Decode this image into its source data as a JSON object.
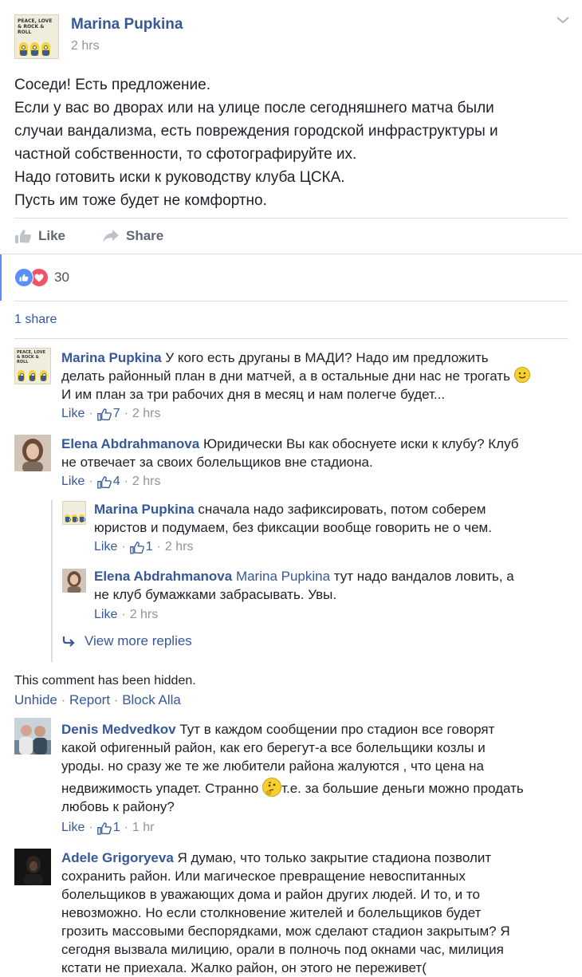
{
  "post": {
    "author": "Marina Pupkina",
    "time": "2 hrs",
    "avatar_text": "PEACE, LOVE & ROCK & ROLL",
    "body_lines": [
      "Соседи! Есть предложение.",
      "Если у вас во дворах или на улице после сегодняшнего матча были",
      "случаи вандализма, есть повреждения городской инфраструктуры и",
      "частной собственности, то сфотографируйте их.",
      "Надо готовить иски к руководству клуба ЦСКА.",
      "Пусть им тоже будет не комфортно."
    ],
    "like_label": "Like",
    "share_label": "Share",
    "reaction_count": "30",
    "shares_label": "1 share",
    "icons": [
      "chevron-down-icon",
      "like-icon",
      "share-icon",
      "love-icon"
    ]
  },
  "comments": [
    {
      "author": "Marina Pupkina",
      "lines": [
        "У кого есть друганы в МАДИ? Надо им предложить",
        "делать районный план в дни матчей, а в остальные дни нас не трогать",
        "И им план за три рабочих дня в месяц и нам полегче будет..."
      ],
      "like": "Like",
      "likes": "7",
      "time": "2 hrs"
    },
    {
      "author": "Elena Abdrahmanova",
      "lines": [
        "Юридически Вы как обоснуете иски к клубу? Клуб",
        "не отвечает за своих болельщиков вне стадиона."
      ],
      "like": "Like",
      "likes": "4",
      "time": "2 hrs"
    }
  ],
  "replies": [
    {
      "author": "Marina Pupkina",
      "lines": [
        "сначала надо зафиксировать, потом соберем",
        "юристов и подумаем, без фиксации вообще говорить не о чем."
      ],
      "like": "Like",
      "likes": "1",
      "time": "2 hrs"
    },
    {
      "author": "Elena Abdrahmanova",
      "mention": "Marina Pupkina",
      "lines": [
        "тут надо вандалов ловить, а",
        "не клуб бумажками забрасывать. Увы."
      ],
      "like": "Like",
      "time": "2 hrs"
    }
  ],
  "view_more_replies": "View more replies",
  "hidden": {
    "text": "This comment has been hidden.",
    "unhide": "Unhide",
    "report": "Report",
    "block": "Block Alla",
    "sep": "·"
  },
  "comments2": [
    {
      "author": "Denis Medvedkov",
      "lines": [
        "Тут в каждом сообщении про стадион все говорят",
        "какой офигенный район, как его берегут-а все болельщики козлы и",
        "уроды. но сразу же те же любители района жалуются , что цена на",
        "недвижимость упадет. Странно",
        "т.е. за большие деньги можно продать",
        "любовь к району?"
      ],
      "like": "Like",
      "likes": "1",
      "time": "1 hr"
    },
    {
      "author": "Adele Grigoryeva",
      "lines": [
        "Я думаю, что только закрытие стадиона позволит",
        "сохранить район. Или магическое превращение невоспитанных",
        "болельщиков в уважающих дома и район других людей. И то, и то",
        "невозможно. Но если столкновение жителей и болельщиков будет",
        "грозить массовыми беспорядками, мож сделают стадион закрытым? Я",
        "сегодня вызвала милицию, орали в полночь под окнами час, милиция",
        "кстати не приехала. Жалко район, он этого не переживет("
      ]
    }
  ]
}
